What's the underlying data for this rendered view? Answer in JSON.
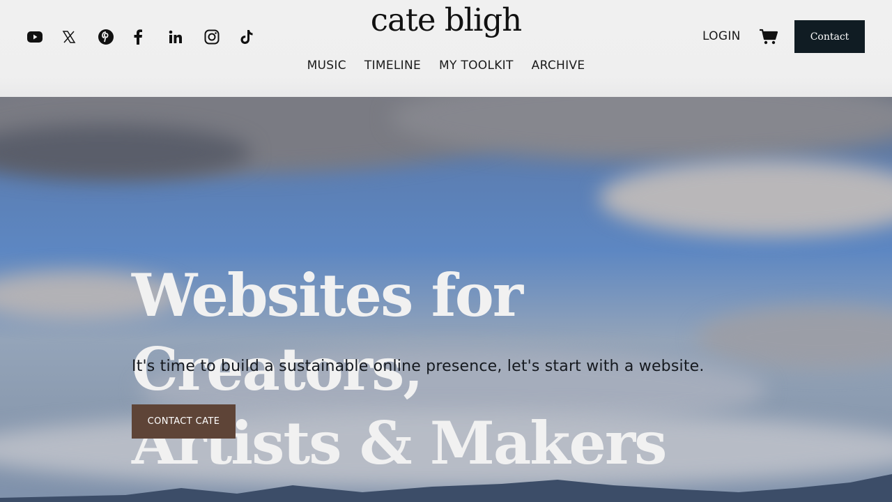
{
  "header": {
    "brand": "cate bligh",
    "socials": [
      {
        "icon": "youtube-icon"
      },
      {
        "icon": "x-twitter-icon"
      },
      {
        "icon": "pinterest-icon"
      },
      {
        "icon": "facebook-icon"
      },
      {
        "icon": "linkedin-icon"
      },
      {
        "icon": "instagram-icon"
      },
      {
        "icon": "tiktok-icon"
      }
    ],
    "nav": [
      "MUSIC",
      "TIMELINE",
      "MY TOOLKIT",
      "ARCHIVE"
    ],
    "login_label": "LOGIN",
    "cart_icon": "cart-icon",
    "contact_label": "Contact"
  },
  "hero": {
    "title_line1": "Websites for Creators,",
    "title_line2": "Artists & Makers",
    "subtitle": "It's time to build a sustainable online presence, let's start with a website.",
    "cta_label": "CONTACT CATE"
  },
  "colors": {
    "contact_button": "#101c23",
    "cta_button": "#5e4437",
    "sky": "#5d87c2"
  }
}
